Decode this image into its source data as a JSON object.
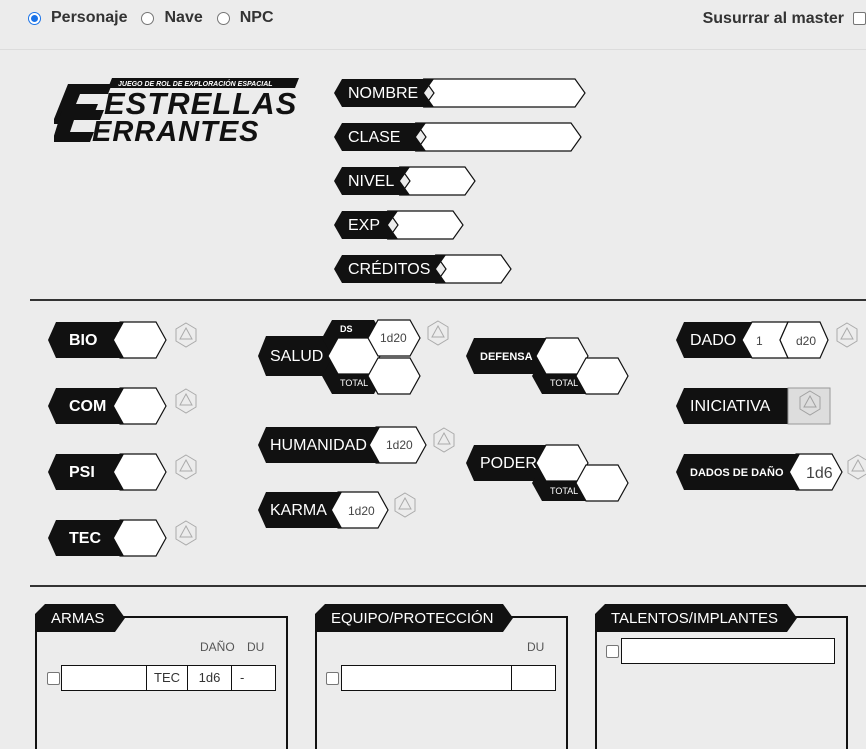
{
  "type_selector": {
    "options": [
      {
        "label": "Personaje",
        "selected": true
      },
      {
        "label": "Nave",
        "selected": false
      },
      {
        "label": "NPC",
        "selected": false
      }
    ]
  },
  "whisper_label": "Susurrar al master",
  "logo": {
    "tagline": "JUEGO DE ROL DE EXPLORACIÓN ESPACIAL",
    "line1": "ESTRELLAS",
    "line2": "ERRANTES"
  },
  "header_fields": {
    "nombre": "NOMBRE",
    "clase": "CLASE",
    "nivel": "NIVEL",
    "exp": "EXP",
    "creditos": "CRÉDITOS"
  },
  "attributes": {
    "bio": "BIO",
    "com": "COM",
    "psi": "PSI",
    "tec": "TEC"
  },
  "salud": {
    "label": "SALUD",
    "ds_label": "DS",
    "die": "1d20",
    "total_label": "TOTAL"
  },
  "humanidad": {
    "label": "HUMANIDAD",
    "die": "1d20"
  },
  "karma": {
    "label": "KARMA",
    "die": "1d20"
  },
  "defensa": {
    "label": "DEFENSA",
    "total_label": "TOTAL"
  },
  "poder": {
    "label": "PODER",
    "total_label": "TOTAL"
  },
  "dado": {
    "label": "DADO",
    "count": "1",
    "type": "d20"
  },
  "iniciativa": {
    "label": "INICIATIVA"
  },
  "dados_dano": {
    "label": "DADOS DE DAÑO",
    "value": "1d6"
  },
  "armas": {
    "title": "ARMAS",
    "col_dano": "DAÑO",
    "col_du": "DU",
    "row": {
      "attr": "TEC",
      "dano": "1d6",
      "du": "-"
    }
  },
  "equipo": {
    "title": "EQUIPO/PROTECCIÓN",
    "col_du": "DU"
  },
  "talentos": {
    "title": "TALENTOS/IMPLANTES"
  },
  "colors": {
    "accent": "#1a73e8",
    "dark": "#111111",
    "bg": "#ececec"
  }
}
